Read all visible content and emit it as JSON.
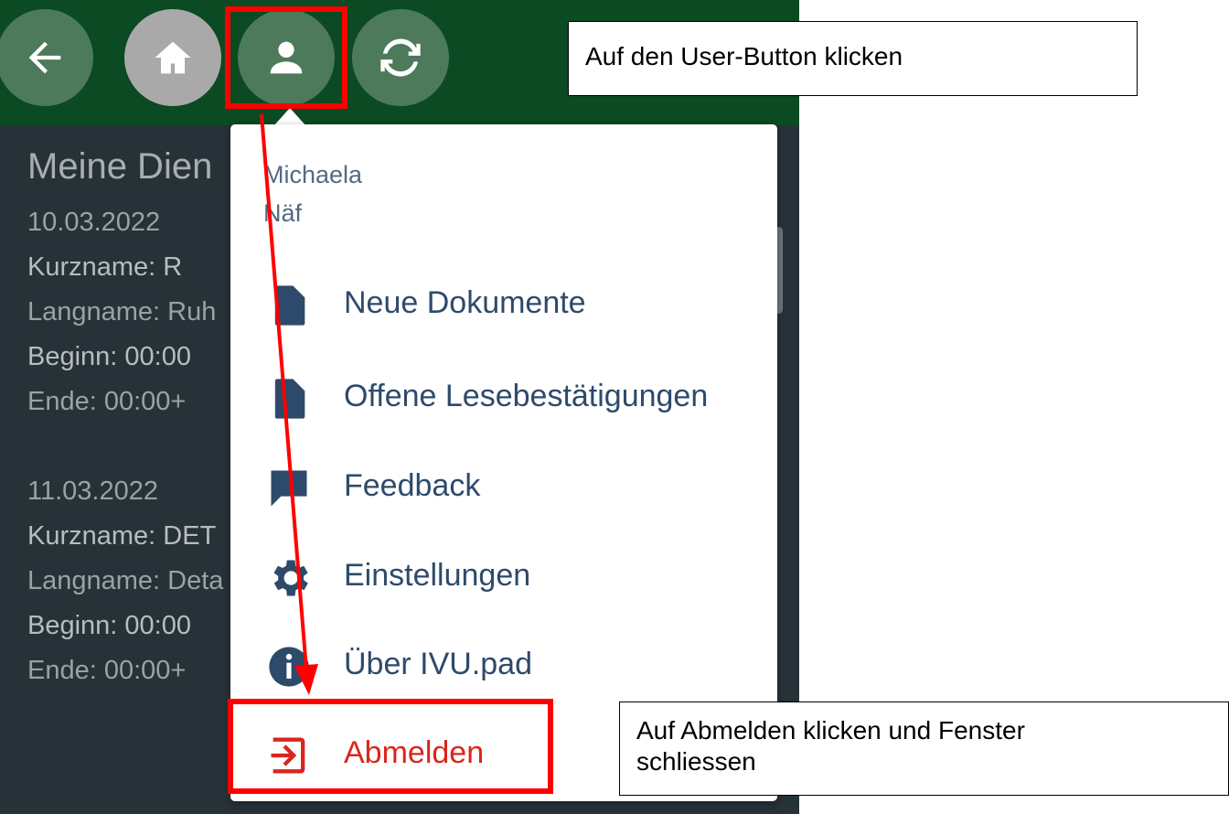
{
  "toolbar": {
    "back_icon": "arrow-left-icon",
    "home_icon": "home-icon",
    "user_icon": "user-icon",
    "sync_icon": "sync-icon"
  },
  "duty": {
    "title": "Meine Dien",
    "entries": [
      {
        "date": "10.03.2022",
        "kurzname": "Kurzname: R",
        "langname": "Langname: Ruh",
        "beginn": "Beginn: 00:00",
        "ende": "Ende: 00:00+"
      },
      {
        "date": "11.03.2022",
        "kurzname": "Kurzname: DET",
        "langname": "Langname: Deta",
        "beginn": "Beginn: 00:00",
        "ende": "Ende: 00:00+"
      }
    ]
  },
  "menu": {
    "user_first": "Michaela",
    "user_last": "Näf",
    "items": [
      {
        "label": "Neue Dokumente",
        "icon": "document-icon"
      },
      {
        "label": "Offene Lesebestätigungen",
        "icon": "document-icon"
      },
      {
        "label": "Feedback",
        "icon": "feedback-icon"
      },
      {
        "label": "Einstellungen",
        "icon": "gear-icon"
      },
      {
        "label": "Über IVU.pad",
        "icon": "info-icon"
      },
      {
        "label": "Abmelden",
        "icon": "logout-icon"
      }
    ]
  },
  "annotations": {
    "callout_user": "Auf den User-Button klicken",
    "callout_logout_line1": "Auf Abmelden klicken und Fenster",
    "callout_logout_line2": "schliessen"
  },
  "colors": {
    "topbar": "#0b4a22",
    "background": "#263238",
    "menu_text": "#2e4a6b",
    "logout": "#d9261c",
    "annotation": "#ff0000"
  }
}
